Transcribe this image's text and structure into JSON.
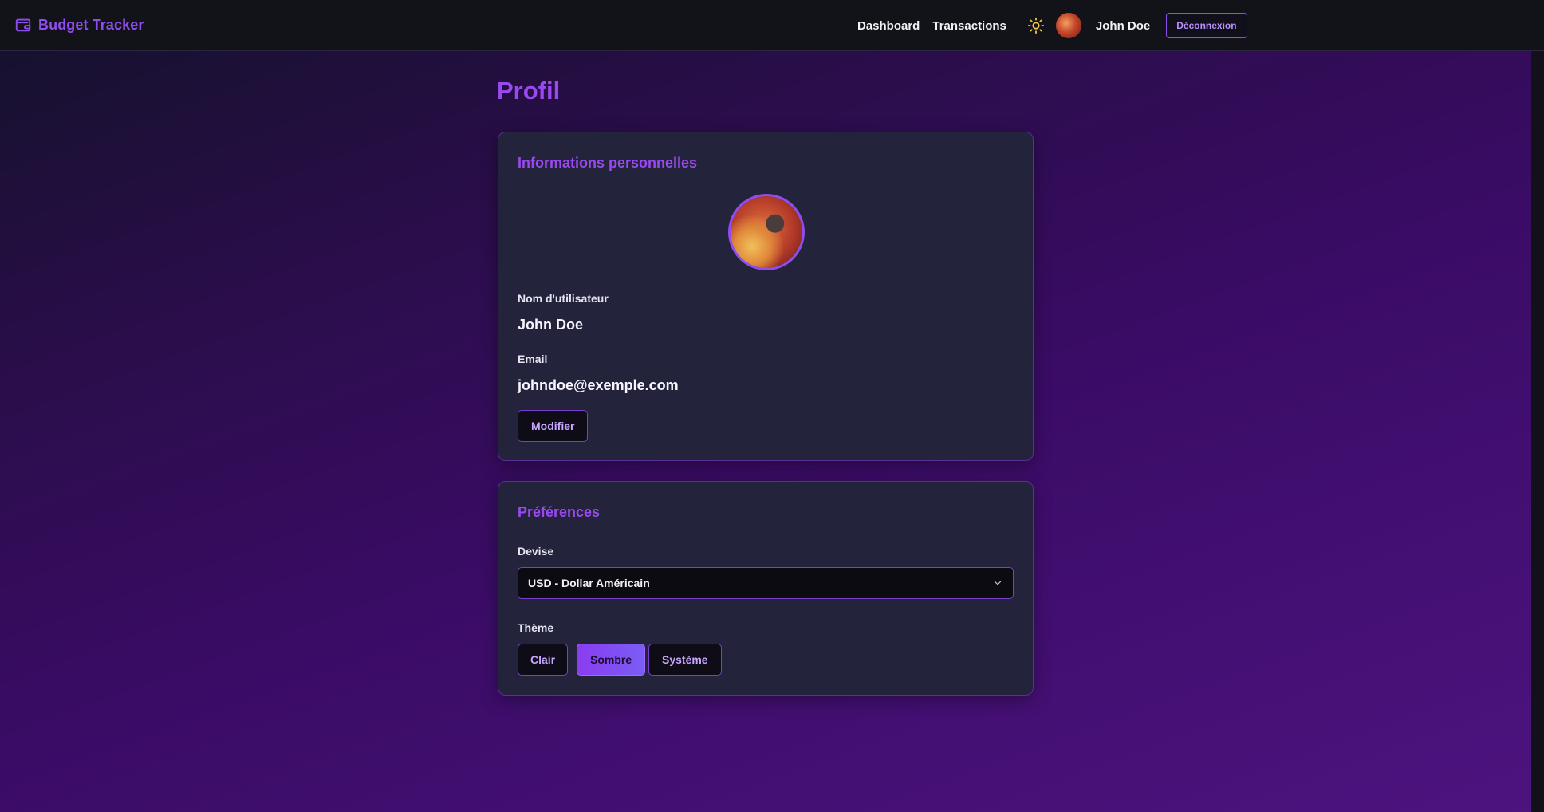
{
  "app": {
    "brand": "Budget Tracker",
    "brand_icon": "wallet-icon",
    "accent_color": "#9a49f0"
  },
  "nav": {
    "links": [
      "Dashboard",
      "Transactions"
    ],
    "theme_toggle_icon": "sun-icon",
    "user_name": "John Doe",
    "logout_label": "Déconnexion"
  },
  "page": {
    "title": "Profil"
  },
  "personal": {
    "heading": "Informations personnelles",
    "username_label": "Nom d'utilisateur",
    "username_value": "John Doe",
    "email_label": "Email",
    "email_value": "johndoe@exemple.com",
    "edit_button": "Modifier"
  },
  "preferences": {
    "heading": "Préférences",
    "currency_label": "Devise",
    "currency_value": "USD - Dollar Américain",
    "theme_label": "Thème",
    "theme_options": [
      "Clair",
      "Sombre",
      "Système"
    ],
    "theme_selected": "Sombre"
  }
}
